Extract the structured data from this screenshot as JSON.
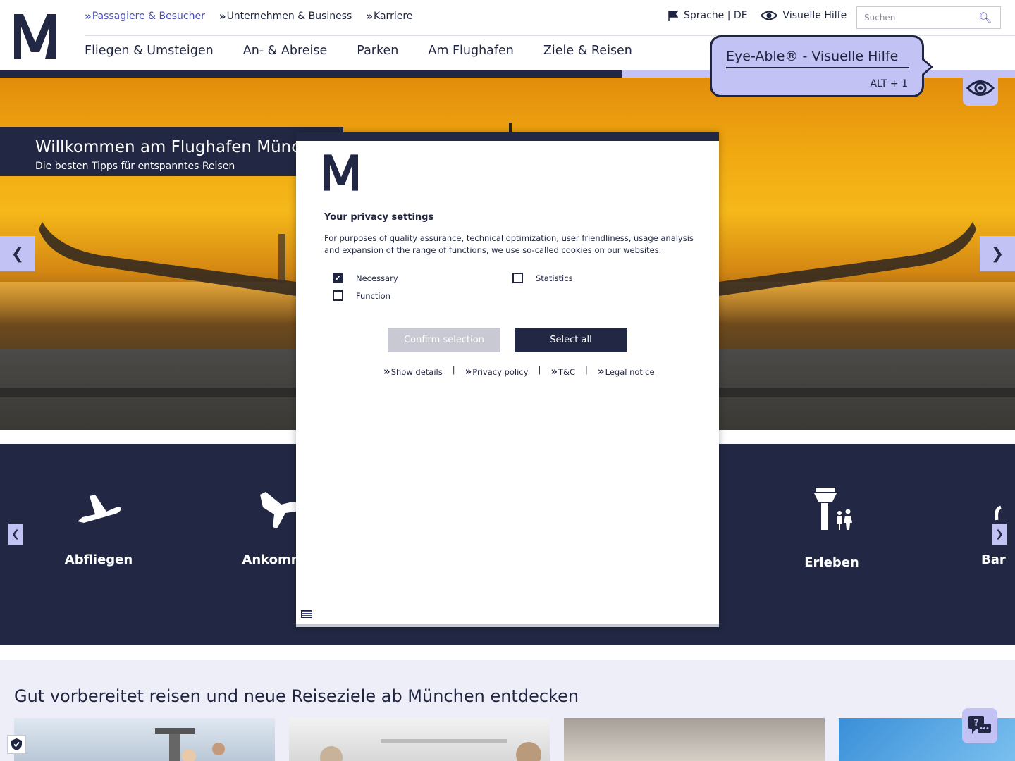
{
  "topnav": {
    "items": [
      {
        "label": "Passagiere & Besucher",
        "active": true
      },
      {
        "label": "Unternehmen & Business",
        "active": false
      },
      {
        "label": "Karriere",
        "active": false
      }
    ]
  },
  "utils": {
    "language": "Sprache | DE",
    "visual_help": "Visuelle Hilfe"
  },
  "search": {
    "placeholder": "Suchen"
  },
  "mainnav": {
    "items": [
      "Fliegen & Umsteigen",
      "An- & Abreise",
      "Parken",
      "Am Flughafen",
      "Ziele & Reisen"
    ]
  },
  "hero": {
    "title": "Willkommen am Flughafen München",
    "subtitle": "Die besten Tipps für entspanntes Reisen",
    "prev": "❮",
    "next": "❯"
  },
  "categories": {
    "items": [
      "Abfliegen",
      "Ankommen",
      "Erleben",
      "Bar"
    ],
    "prev": "❮",
    "next": "❯"
  },
  "lower": {
    "title": "Gut vorbereitet reisen und neue Reiseziele ab München entdecken"
  },
  "privacy": {
    "title": "Your privacy settings",
    "text": "For purposes of quality assurance, technical optimization, user friendliness, usage analysis and expansion of the range of functions, we use so-called cookies on our websites.",
    "options": [
      {
        "label": "Necessary",
        "checked": true
      },
      {
        "label": "Statistics",
        "checked": false
      },
      {
        "label": "Function",
        "checked": false
      }
    ],
    "confirm_label": "Confirm selection",
    "select_all_label": "Select all",
    "links": [
      "Show details",
      "Privacy policy",
      "T&C",
      "Legal notice"
    ],
    "separator": "|"
  },
  "eyeable": {
    "title": "Eye-Able® - Visuelle Hilfe",
    "shortcut": "ALT + 1"
  },
  "colors": {
    "navy": "#222843",
    "lavender": "#c2c3f4",
    "accent": "#4a4fb5"
  }
}
